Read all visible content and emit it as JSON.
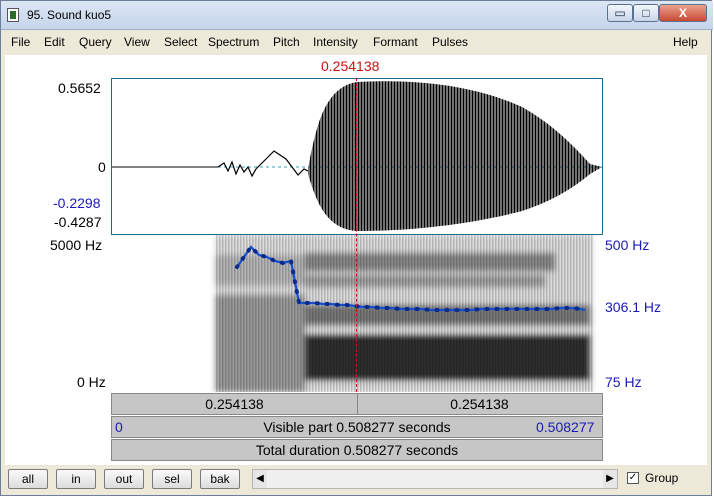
{
  "window": {
    "title": "95. Sound kuo5",
    "minimize_glyph": "▭",
    "maximize_glyph": "□",
    "close_glyph": "X"
  },
  "menu": [
    "File",
    "Edit",
    "Query",
    "View",
    "Select",
    "Spectrum",
    "Pitch",
    "Intensity",
    "Formant",
    "Pulses"
  ],
  "menu_help": "Help",
  "waveform": {
    "cursor_time": "0.254138",
    "y_max": "0.5652",
    "y_zero": "0",
    "y_cursor_value": "-0.2298",
    "y_min": "-0.4287"
  },
  "spectrogram": {
    "freq_top": "5000 Hz",
    "freq_bottom": "0 Hz",
    "pitch_top": "500 Hz",
    "pitch_cursor": "306.1 Hz",
    "pitch_bottom": "75 Hz"
  },
  "time_bars": {
    "left_segment": "0.254138",
    "right_segment": "0.254138",
    "visible_start": "0",
    "visible_part_text": "Visible part 0.508277 seconds",
    "visible_end": "0.508277",
    "total_duration_text": "Total duration 0.508277 seconds"
  },
  "buttons": {
    "all": "all",
    "in": "in",
    "out": "out",
    "sel": "sel",
    "bak": "bak"
  },
  "scroll": {
    "left_glyph": "◀",
    "right_glyph": "▶"
  },
  "group": {
    "label": "Group",
    "checked": true,
    "check_glyph": "✓"
  },
  "colors": {
    "cursor": "#cc1111",
    "pitch_curve": "#1450d2",
    "axis_blue": "#1a1ab4"
  }
}
